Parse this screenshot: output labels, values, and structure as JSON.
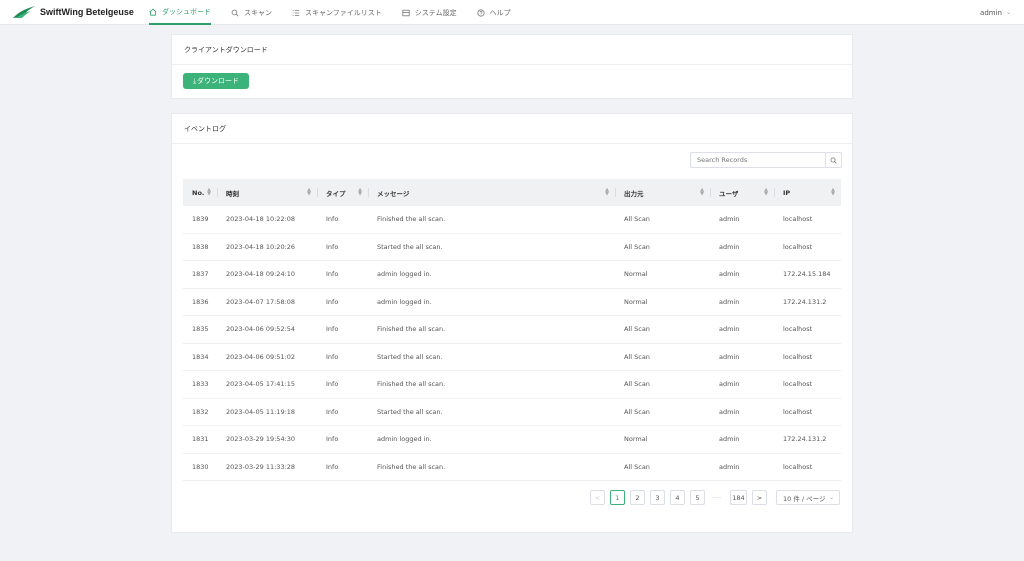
{
  "app": {
    "name": "SwiftWing Betelgeuse",
    "brand_color": "#2e9e6a"
  },
  "nav": [
    {
      "label": "ダッシュボード",
      "icon": "home-icon",
      "active": true
    },
    {
      "label": "スキャン",
      "icon": "search-icon"
    },
    {
      "label": "スキャンファイルリスト",
      "icon": "list-icon"
    },
    {
      "label": "システム設定",
      "icon": "settings-icon"
    },
    {
      "label": "ヘルプ",
      "icon": "help-icon"
    }
  ],
  "user": {
    "name": "admin"
  },
  "client_download": {
    "title": "クライアントダウンロード",
    "button_label": "ダウンロード"
  },
  "event_log": {
    "title": "イベントログ",
    "search_placeholder": "Search Records",
    "columns": [
      "No.",
      "時刻",
      "タイプ",
      "メッセージ",
      "出力元",
      "ユーザ",
      "IP"
    ],
    "rows": [
      [
        "1839",
        "2023-04-18 10:22:08",
        "Info",
        "Finished the all scan.",
        "All Scan",
        "admin",
        "localhost"
      ],
      [
        "1838",
        "2023-04-18 10:20:26",
        "Info",
        "Started the all scan.",
        "All Scan",
        "admin",
        "localhost"
      ],
      [
        "1837",
        "2023-04-18 09:24:10",
        "Info",
        "admin logged in.",
        "Normal",
        "admin",
        "172.24.15.184"
      ],
      [
        "1836",
        "2023-04-07 17:58:08",
        "Info",
        "admin logged in.",
        "Normal",
        "admin",
        "172.24.131.2"
      ],
      [
        "1835",
        "2023-04-06 09:52:54",
        "Info",
        "Finished the all scan.",
        "All Scan",
        "admin",
        "localhost"
      ],
      [
        "1834",
        "2023-04-06 09:51:02",
        "Info",
        "Started the all scan.",
        "All Scan",
        "admin",
        "localhost"
      ],
      [
        "1833",
        "2023-04-05 17:41:15",
        "Info",
        "Finished the all scan.",
        "All Scan",
        "admin",
        "localhost"
      ],
      [
        "1832",
        "2023-04-05 11:19:18",
        "Info",
        "Started the all scan.",
        "All Scan",
        "admin",
        "localhost"
      ],
      [
        "1831",
        "2023-03-29 19:54:30",
        "Info",
        "admin logged in.",
        "Normal",
        "admin",
        "172.24.131.2"
      ],
      [
        "1830",
        "2023-03-29 11:33:28",
        "Info",
        "Finished the all scan.",
        "All Scan",
        "admin",
        "localhost"
      ]
    ],
    "pagination": {
      "prev": "<",
      "pages": [
        "1",
        "2",
        "3",
        "4",
        "5"
      ],
      "current": "1",
      "ellipsis": "···",
      "last": "184",
      "next": ">",
      "page_size": "10 件 / ページ"
    }
  }
}
